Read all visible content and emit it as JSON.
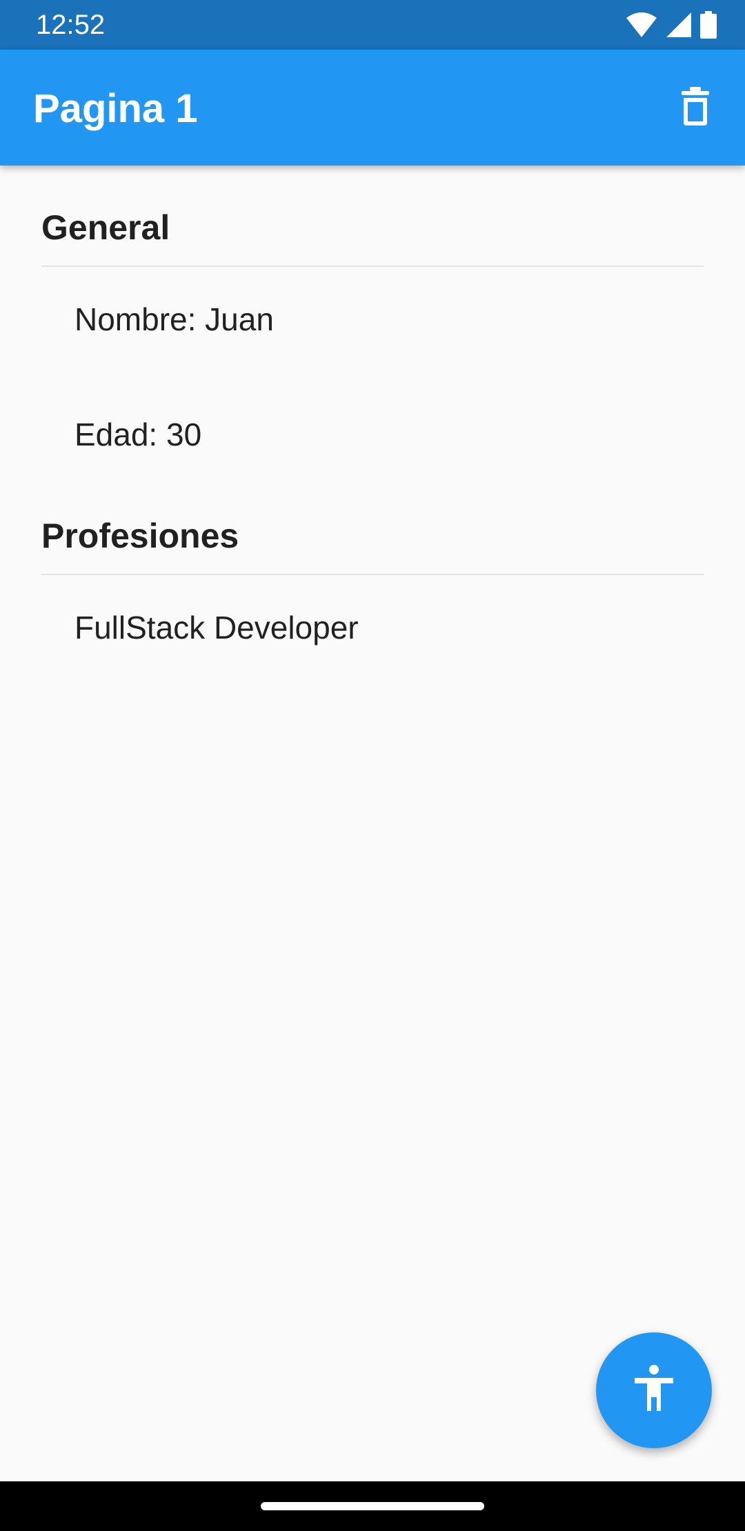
{
  "status_bar": {
    "time": "12:52",
    "icons": [
      "wifi-icon",
      "cell-signal-icon",
      "battery-icon"
    ]
  },
  "app_bar": {
    "title": "Pagina 1",
    "action_icon": "delete-icon"
  },
  "sections": [
    {
      "header": "General",
      "items": [
        "Nombre: Juan",
        "Edad: 30"
      ]
    },
    {
      "header": "Profesiones",
      "items": [
        "FullStack Developer"
      ]
    }
  ],
  "fab": {
    "icon": "accessibility-icon"
  },
  "colors": {
    "status_bar": "#1a72ba",
    "primary": "#2196f3",
    "background": "#fafafa",
    "text": "#212121",
    "divider": "#e3e3e3"
  }
}
